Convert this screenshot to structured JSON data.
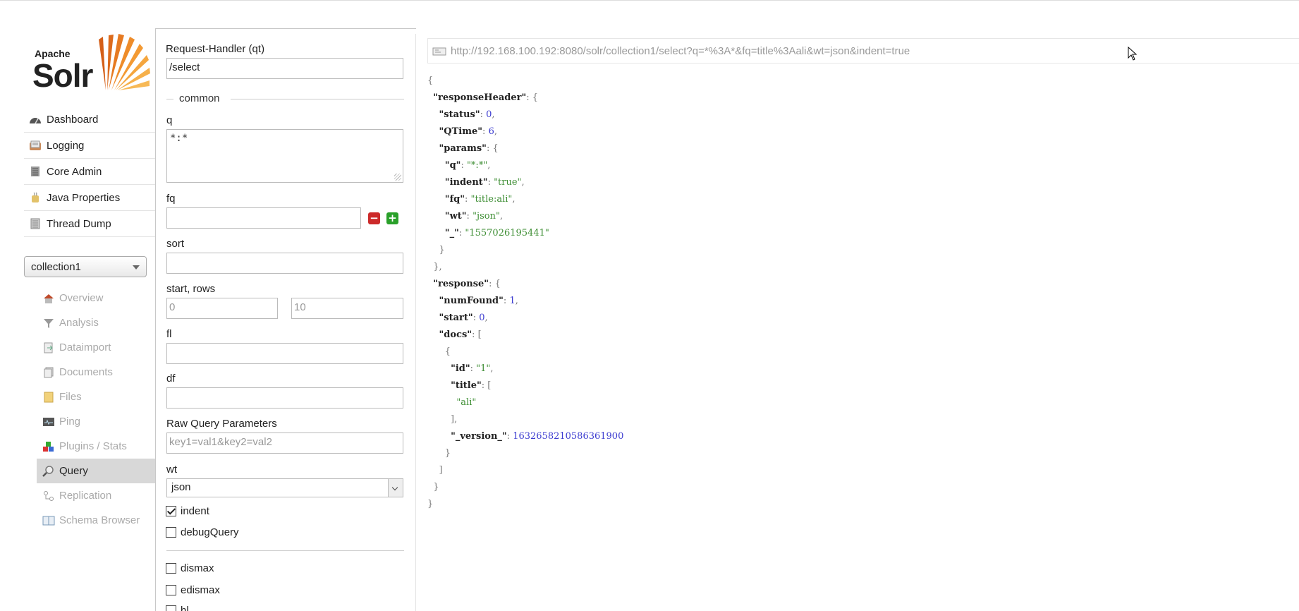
{
  "logo": {
    "line1": "Apache",
    "line2": "Solr"
  },
  "nav": [
    {
      "label": "Dashboard",
      "icon": "dashboard-icon"
    },
    {
      "label": "Logging",
      "icon": "logging-icon"
    },
    {
      "label": "Core Admin",
      "icon": "core-admin-icon"
    },
    {
      "label": "Java Properties",
      "icon": "java-icon"
    },
    {
      "label": "Thread Dump",
      "icon": "thread-dump-icon"
    }
  ],
  "core_selector": {
    "value": "collection1"
  },
  "core_menu": [
    {
      "label": "Overview",
      "icon": "home-icon"
    },
    {
      "label": "Analysis",
      "icon": "funnel-icon"
    },
    {
      "label": "Dataimport",
      "icon": "dataimport-icon"
    },
    {
      "label": "Documents",
      "icon": "documents-icon"
    },
    {
      "label": "Files",
      "icon": "folder-icon"
    },
    {
      "label": "Ping",
      "icon": "ping-icon"
    },
    {
      "label": "Plugins / Stats",
      "icon": "plugins-icon"
    },
    {
      "label": "Query",
      "icon": "magnifier-icon",
      "active": true
    },
    {
      "label": "Replication",
      "icon": "replication-icon"
    },
    {
      "label": "Schema Browser",
      "icon": "schema-icon"
    }
  ],
  "form": {
    "request_handler_label": "Request-Handler (qt)",
    "request_handler_value": "/select",
    "common_legend": "common",
    "q_label": "q",
    "q_value": "*:*",
    "fq_label": "fq",
    "fq_value": "",
    "sort_label": "sort",
    "sort_value": "",
    "start_rows_label": "start, rows",
    "start_placeholder": "0",
    "rows_placeholder": "10",
    "fl_label": "fl",
    "fl_value": "",
    "df_label": "df",
    "df_value": "",
    "raw_label": "Raw Query Parameters",
    "raw_placeholder": "key1=val1&key2=val2",
    "wt_label": "wt",
    "wt_value": "json",
    "indent_label": "indent",
    "indent_checked": true,
    "debug_label": "debugQuery",
    "debug_checked": false,
    "dismax_label": "dismax",
    "edismax_label": "edismax",
    "hl_label": "hl"
  },
  "result": {
    "url": "http://192.168.100.192:8080/solr/collection1/select?q=*%3A*&fq=title%3Aali&wt=json&indent=true"
  },
  "colors": {
    "string": "#3e8e34",
    "number": "#3b3bd0",
    "active_bg": "#d8d8d8"
  }
}
